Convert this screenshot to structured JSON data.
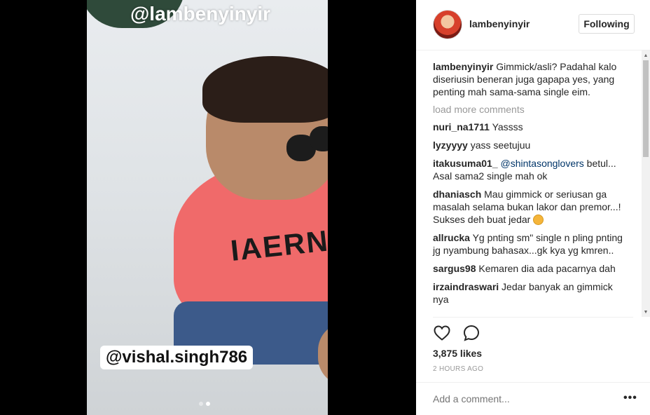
{
  "media": {
    "watermark": "@lambenyinyir",
    "shirt_text": "IAERNU",
    "tag": "@vishal.singh786",
    "carousel": {
      "count": 2,
      "active": 1
    }
  },
  "header": {
    "username": "lambenyinyir",
    "follow_label": "Following"
  },
  "caption": {
    "user": "lambenyinyir",
    "text": "Gimmick/asli? Padahal kalo diseriusin beneran juga gapapa yes, yang penting mah sama-sama single eim."
  },
  "load_more": "load more comments",
  "comments": [
    {
      "user": "nuri_na1711",
      "text": "Yassss"
    },
    {
      "user": "lyzyyyy",
      "text": "yass seetujuu"
    },
    {
      "user": "itakusuma01_",
      "mention": "@shintasonglovers",
      "text": "betul... Asal sama2 single mah ok"
    },
    {
      "user": "dhaniasch",
      "text": "Mau gimmick or seriusan ga masalah selama bukan lakor dan premor...! Sukses deh buat jedar"
    },
    {
      "user": "allrucka",
      "text": "Yg pnting sm\" single n pling pnting jg nyambung bahasax...gk kya yg kmren.."
    },
    {
      "user": "sargus98",
      "text": "Kemaren dia ada pacarnya dah"
    },
    {
      "user": "irzaindraswari",
      "text": "Jedar banyak an gimmick nya"
    }
  ],
  "likes": "3,875 likes",
  "time": "2 HOURS AGO",
  "add_comment_placeholder": "Add a comment...",
  "more_label": "•••",
  "icons": [
    "heart-icon",
    "comment-icon",
    "more-icon",
    "scroll-up-icon",
    "scroll-down-icon"
  ]
}
